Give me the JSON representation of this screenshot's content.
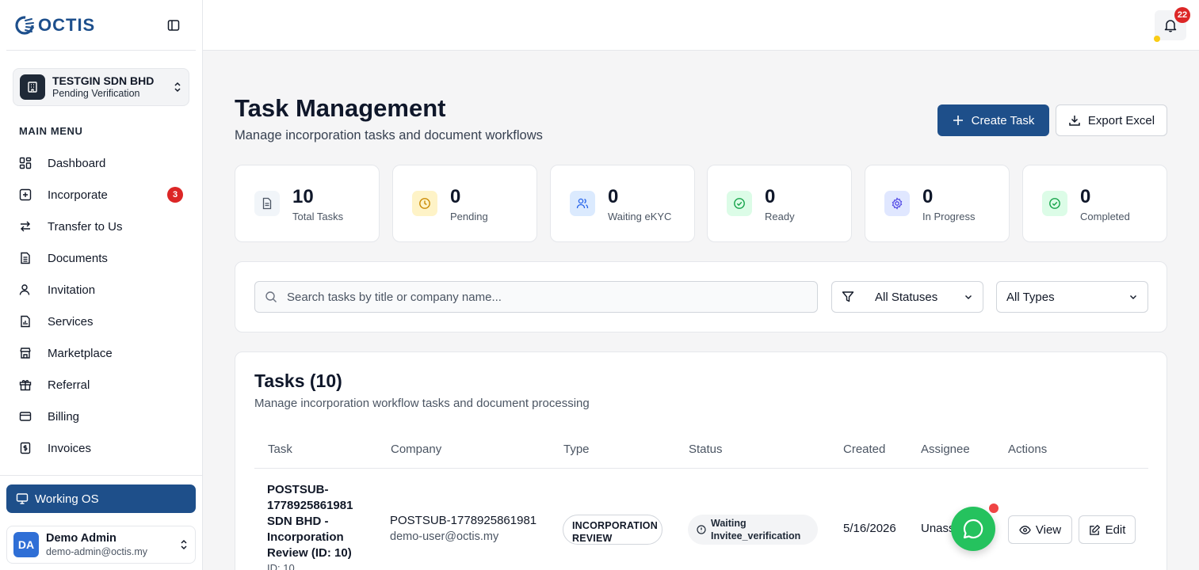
{
  "app": {
    "logo_text": "OCTIS",
    "brand_color": "#1e4f8a"
  },
  "org": {
    "name": "TESTGIN SDN BHD",
    "status": "Pending Verification"
  },
  "sidebar": {
    "menu_heading": "MAIN MENU",
    "items": [
      {
        "label": "Dashboard",
        "icon": "dashboard-icon"
      },
      {
        "label": "Incorporate",
        "icon": "plus-square-icon",
        "badge": "3"
      },
      {
        "label": "Transfer to Us",
        "icon": "transfer-icon"
      },
      {
        "label": "Documents",
        "icon": "document-icon"
      },
      {
        "label": "Invitation",
        "icon": "user-icon"
      },
      {
        "label": "Services",
        "icon": "services-icon"
      },
      {
        "label": "Marketplace",
        "icon": "store-icon"
      },
      {
        "label": "Referral",
        "icon": "gift-icon"
      },
      {
        "label": "Billing",
        "icon": "card-icon"
      },
      {
        "label": "Invoices",
        "icon": "invoice-icon"
      }
    ],
    "working_os": "Working OS"
  },
  "user": {
    "initials": "DA",
    "name": "Demo Admin",
    "email": "demo-admin@octis.my"
  },
  "topbar": {
    "notification_count": "22"
  },
  "header": {
    "title": "Task Management",
    "subtitle": "Manage incorporation tasks and document workflows",
    "create_label": "Create Task",
    "export_label": "Export Excel"
  },
  "stats": [
    {
      "value": "10",
      "label": "Total Tasks",
      "icon": "file-icon"
    },
    {
      "value": "0",
      "label": "Pending",
      "icon": "clock-icon"
    },
    {
      "value": "0",
      "label": "Waiting eKYC",
      "icon": "users-icon"
    },
    {
      "value": "0",
      "label": "Ready",
      "icon": "check-circle-icon"
    },
    {
      "value": "0",
      "label": "In Progress",
      "icon": "gear-icon"
    },
    {
      "value": "0",
      "label": "Completed",
      "icon": "check-circle-icon"
    }
  ],
  "filters": {
    "search_placeholder": "Search tasks by title or company name...",
    "status_value": "All Statuses",
    "type_value": "All Types"
  },
  "tasks": {
    "title": "Tasks (10)",
    "subtitle": "Manage incorporation workflow tasks and document processing",
    "columns": [
      "Task",
      "Company",
      "Type",
      "Status",
      "Created",
      "Assignee",
      "Actions"
    ],
    "rows": [
      {
        "task": "POSTSUB-1778925861981 SDN BHD - Incorporation Review (ID: 10)",
        "task_id": "ID: 10",
        "company": "POSTSUB-1778925861981",
        "company_email": "demo-user@octis.my",
        "type": "INCORPORATION REVIEW",
        "status": "Waiting Invitee_verification",
        "created": "5/16/2026",
        "assignee": "Unassigned",
        "view_label": "View",
        "edit_label": "Edit"
      }
    ]
  }
}
